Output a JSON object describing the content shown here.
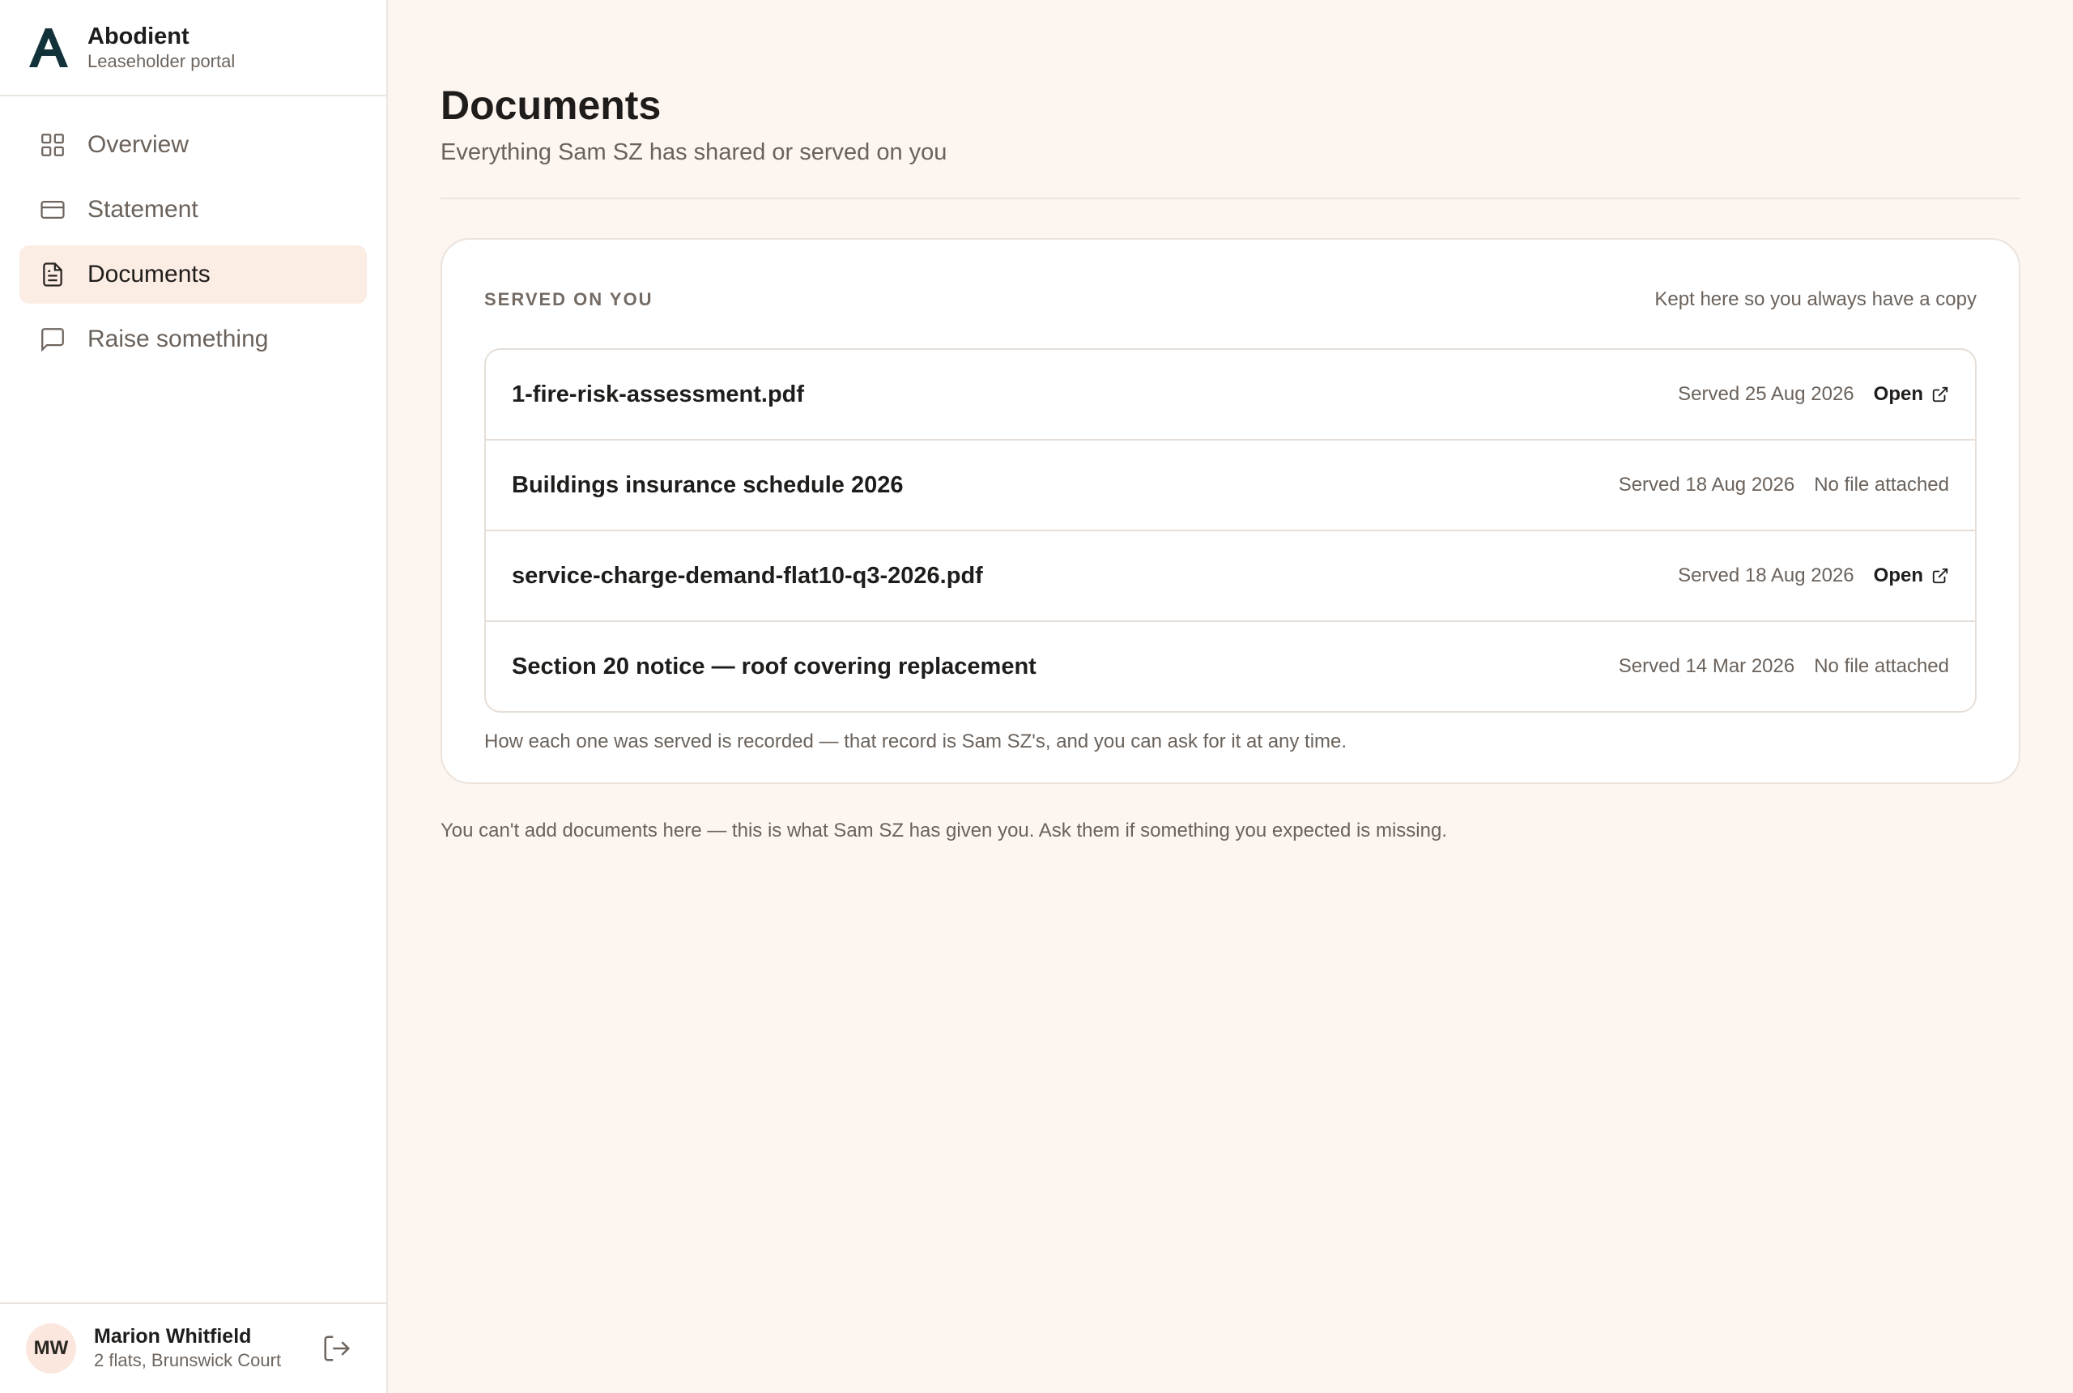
{
  "brand": {
    "name": "Abodient",
    "subtitle": "Leaseholder portal"
  },
  "nav": [
    {
      "label": "Overview",
      "icon": "grid-icon",
      "active": false
    },
    {
      "label": "Statement",
      "icon": "card-icon",
      "active": false
    },
    {
      "label": "Documents",
      "icon": "document-icon",
      "active": true
    },
    {
      "label": "Raise something",
      "icon": "message-icon",
      "active": false
    }
  ],
  "user": {
    "initials": "MW",
    "name": "Marion Whitfield",
    "detail": "2 flats, Brunswick Court"
  },
  "page": {
    "title": "Documents",
    "subtitle": "Everything Sam SZ has shared or served on you"
  },
  "served": {
    "label": "SERVED ON YOU",
    "note": "Kept here so you always have a copy",
    "items": [
      {
        "title": "1-fire-risk-assessment.pdf",
        "date": "Served 25 Aug 2026",
        "action": "Open"
      },
      {
        "title": "Buildings insurance schedule 2026",
        "date": "Served 18 Aug 2026",
        "status": "No file attached"
      },
      {
        "title": "service-charge-demand-flat10-q3-2026.pdf",
        "date": "Served 18 Aug 2026",
        "action": "Open"
      },
      {
        "title": "Section 20 notice — roof covering replacement",
        "date": "Served 14 Mar 2026",
        "status": "No file attached"
      }
    ],
    "footnote": "How each one was served is recorded — that record is Sam SZ's, and you can ask for it at any time."
  },
  "page_footnote": "You can't add documents here — this is what Sam SZ has given you. Ask them if something you expected is missing.",
  "colors": {
    "brand": "#12323a",
    "active_bg": "#fbece4",
    "page_bg": "#fdf5f0"
  }
}
